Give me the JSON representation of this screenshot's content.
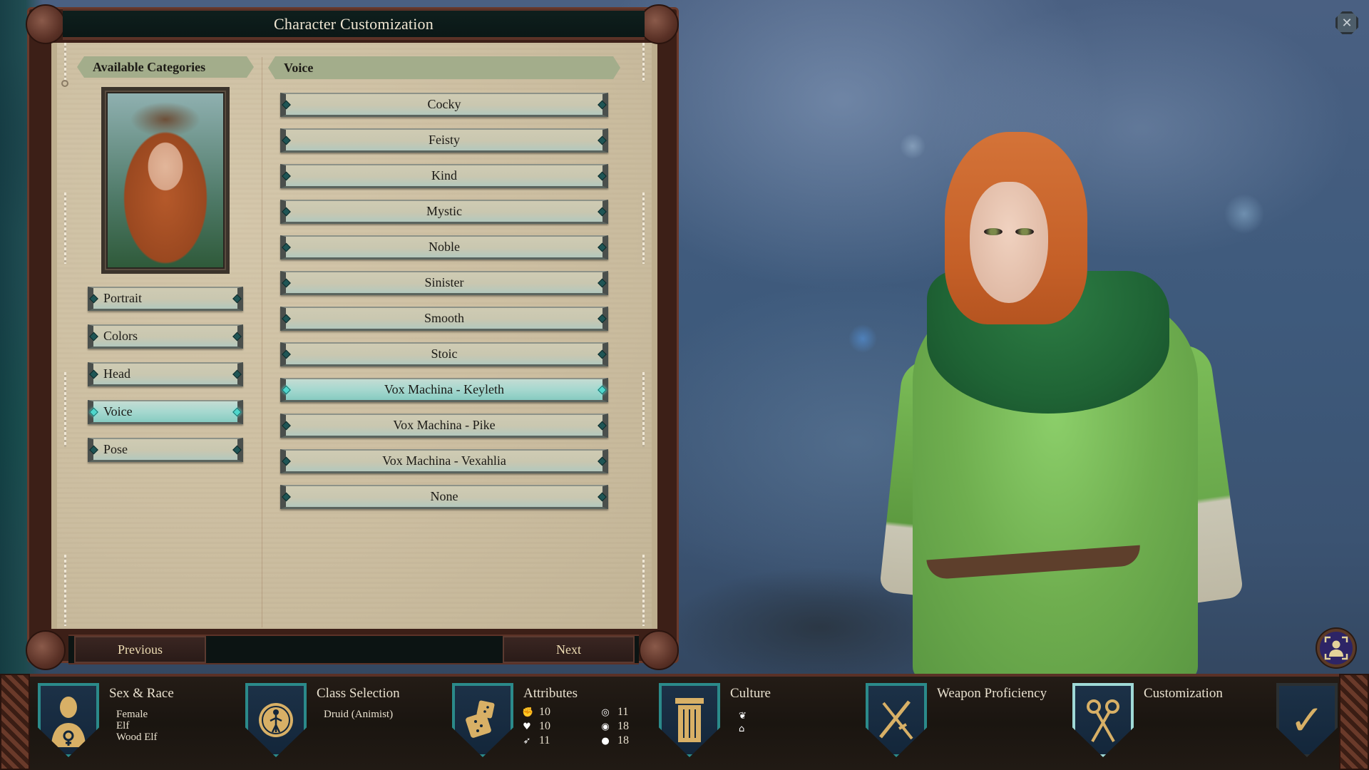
{
  "window": {
    "title": "Character Customization"
  },
  "icons": {
    "close": "✕",
    "portrait_toggle": "👤",
    "gem": "◆"
  },
  "left_panel": {
    "header": "Available Categories",
    "categories": [
      {
        "label": "Portrait",
        "selected": false
      },
      {
        "label": "Colors",
        "selected": false
      },
      {
        "label": "Head",
        "selected": false
      },
      {
        "label": "Voice",
        "selected": true
      },
      {
        "label": "Pose",
        "selected": false
      }
    ]
  },
  "right_panel": {
    "header": "Voice",
    "options": [
      {
        "label": "Cocky",
        "selected": false
      },
      {
        "label": "Feisty",
        "selected": false
      },
      {
        "label": "Kind",
        "selected": false
      },
      {
        "label": "Mystic",
        "selected": false
      },
      {
        "label": "Noble",
        "selected": false
      },
      {
        "label": "Sinister",
        "selected": false
      },
      {
        "label": "Smooth",
        "selected": false
      },
      {
        "label": "Stoic",
        "selected": false
      },
      {
        "label": "Vox Machina - Keyleth",
        "selected": true
      },
      {
        "label": "Vox Machina - Pike",
        "selected": false
      },
      {
        "label": "Vox Machina - Vexahlia",
        "selected": false
      },
      {
        "label": "None",
        "selected": false
      }
    ]
  },
  "navigation": {
    "previous": "Previous",
    "next": "Next"
  },
  "steps": {
    "sex_race": {
      "title": "Sex & Race",
      "icon": "bust-female-icon",
      "lines": [
        "Female",
        "Elf",
        "Wood Elf"
      ]
    },
    "class": {
      "title": "Class Selection",
      "icon": "druid-sigil-icon",
      "lines": [
        "Druid (Animist)"
      ]
    },
    "attributes": {
      "title": "Attributes",
      "icon": "dice-icon",
      "values": [
        {
          "name": "might",
          "glyph": "💪",
          "value": "10"
        },
        {
          "name": "intellect",
          "glyph": "◎",
          "value": "11"
        },
        {
          "name": "constitution",
          "glyph": "♥",
          "value": "10"
        },
        {
          "name": "perception",
          "glyph": "◉",
          "value": "18"
        },
        {
          "name": "dexterity",
          "glyph": "➶",
          "value": "11"
        },
        {
          "name": "resolve",
          "glyph": "●",
          "value": "18"
        }
      ]
    },
    "culture": {
      "title": "Culture",
      "icon": "pillar-icon",
      "glyphs": [
        "❦",
        "⌂"
      ]
    },
    "weapon": {
      "title": "Weapon Proficiency",
      "icon": "crossed-weapons-icon"
    },
    "customization": {
      "title": "Customization",
      "icon": "scissors-icon",
      "active": true
    },
    "confirm": {
      "icon": "checkmark-icon",
      "glyph": "✓"
    }
  },
  "colors": {
    "selected_button": "#8fd2c8",
    "gem_selected": "#4fd6cc",
    "shield_border": "#2b8a8a",
    "gold_icon": "#d8b066",
    "parchment": "#cdbfa2"
  }
}
